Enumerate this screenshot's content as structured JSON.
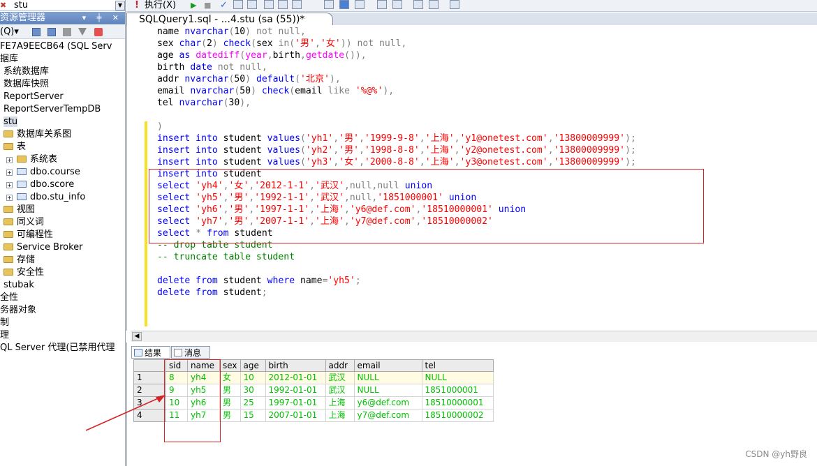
{
  "explorer": {
    "db_selector": "stu",
    "title": "资源管理器",
    "window_buttons": "▾ ╪ ✕",
    "connect_label": "(Q)▾",
    "tree": [
      {
        "label": "FE7A9EECB64 (SQL Serv",
        "type": "text",
        "indent": 0
      },
      {
        "label": "据库",
        "type": "text",
        "indent": 0
      },
      {
        "label": "系统数据库",
        "type": "text",
        "indent": 6
      },
      {
        "label": "数据库快照",
        "type": "text",
        "indent": 6
      },
      {
        "label": "ReportServer",
        "type": "text",
        "indent": 6
      },
      {
        "label": "ReportServerTempDB",
        "type": "text",
        "indent": 6
      },
      {
        "label": "stu",
        "type": "selected",
        "indent": 6
      },
      {
        "label": "数据库关系图",
        "type": "folder",
        "indent": 6
      },
      {
        "label": "表",
        "type": "folder",
        "indent": 6
      },
      {
        "label": "系统表",
        "type": "folder-exp",
        "indent": 10
      },
      {
        "label": "dbo.course",
        "type": "table-exp",
        "indent": 10
      },
      {
        "label": "dbo.score",
        "type": "table-exp",
        "indent": 10
      },
      {
        "label": "dbo.stu_info",
        "type": "table-exp",
        "indent": 10
      },
      {
        "label": "视图",
        "type": "folder",
        "indent": 6
      },
      {
        "label": "同义词",
        "type": "folder",
        "indent": 6
      },
      {
        "label": "可编程性",
        "type": "folder",
        "indent": 6
      },
      {
        "label": "Service Broker",
        "type": "folder",
        "indent": 6
      },
      {
        "label": "存储",
        "type": "folder",
        "indent": 6
      },
      {
        "label": "安全性",
        "type": "folder",
        "indent": 6
      },
      {
        "label": "stubak",
        "type": "text",
        "indent": 6
      },
      {
        "label": "全性",
        "type": "text",
        "indent": 0
      },
      {
        "label": "务器对象",
        "type": "text",
        "indent": 0
      },
      {
        "label": "制",
        "type": "text",
        "indent": 0
      },
      {
        "label": "理",
        "type": "text",
        "indent": 0
      },
      {
        "label": "QL Server 代理(已禁用代理",
        "type": "text",
        "indent": 0
      }
    ]
  },
  "toolbar": {
    "execute_label": "执行(X)"
  },
  "editor": {
    "tab_title": "SQLQuery1.sql - ...4.stu (sa (55))*"
  },
  "results": {
    "tab_results": "结果",
    "tab_messages": "消息",
    "columns": [
      "sid",
      "name",
      "sex",
      "age",
      "birth",
      "addr",
      "email",
      "tel"
    ],
    "rows": [
      {
        "n": "1",
        "cells": [
          "8",
          "yh4",
          "女",
          "10",
          "2012-01-01",
          "武汉",
          "NULL",
          "NULL"
        ]
      },
      {
        "n": "2",
        "cells": [
          "9",
          "yh5",
          "男",
          "30",
          "1992-01-01",
          "武汉",
          "NULL",
          "1851000001"
        ]
      },
      {
        "n": "3",
        "cells": [
          "10",
          "yh6",
          "男",
          "25",
          "1997-01-01",
          "上海",
          "y6@def.com",
          "18510000001"
        ]
      },
      {
        "n": "4",
        "cells": [
          "11",
          "yh7",
          "男",
          "15",
          "2007-01-01",
          "上海",
          "y7@def.com",
          "18510000002"
        ]
      }
    ]
  },
  "watermark": "CSDN @yh野良"
}
